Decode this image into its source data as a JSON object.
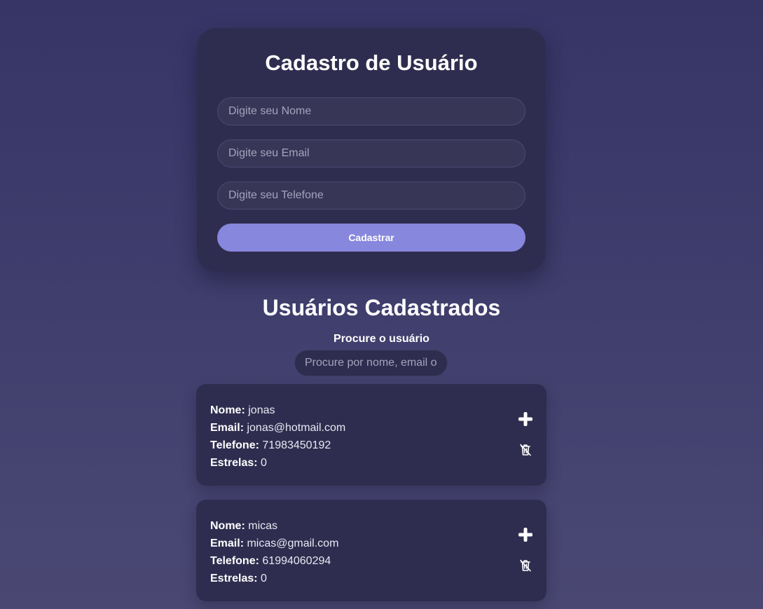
{
  "form": {
    "title": "Cadastro de Usuário",
    "name_placeholder": "Digite seu Nome",
    "email_placeholder": "Digite seu Email",
    "phone_placeholder": "Digite seu Telefone",
    "submit_label": "Cadastrar"
  },
  "list": {
    "title": "Usuários Cadastrados",
    "search_label": "Procure o usuário",
    "search_placeholder": "Procure por nome, email ou telefone",
    "field_labels": {
      "name": "Nome:",
      "email": "Email:",
      "phone": "Telefone:",
      "stars": "Estrelas:"
    },
    "users": [
      {
        "name": "jonas",
        "email": "jonas@hotmail.com",
        "phone": "71983450192",
        "stars": "0",
        "add_icon": "plus-icon",
        "delete_icon": "trash-icon"
      },
      {
        "name": "micas",
        "email": "micas@gmail.com",
        "phone": "61994060294",
        "stars": "0",
        "add_icon": "plus-icon",
        "delete_icon": "trash-icon"
      }
    ]
  },
  "colors": {
    "background": "#3f3d6c",
    "card": "#2f2d4f",
    "input": "#383657",
    "accent": "#8887de",
    "text": "#ffffff"
  }
}
